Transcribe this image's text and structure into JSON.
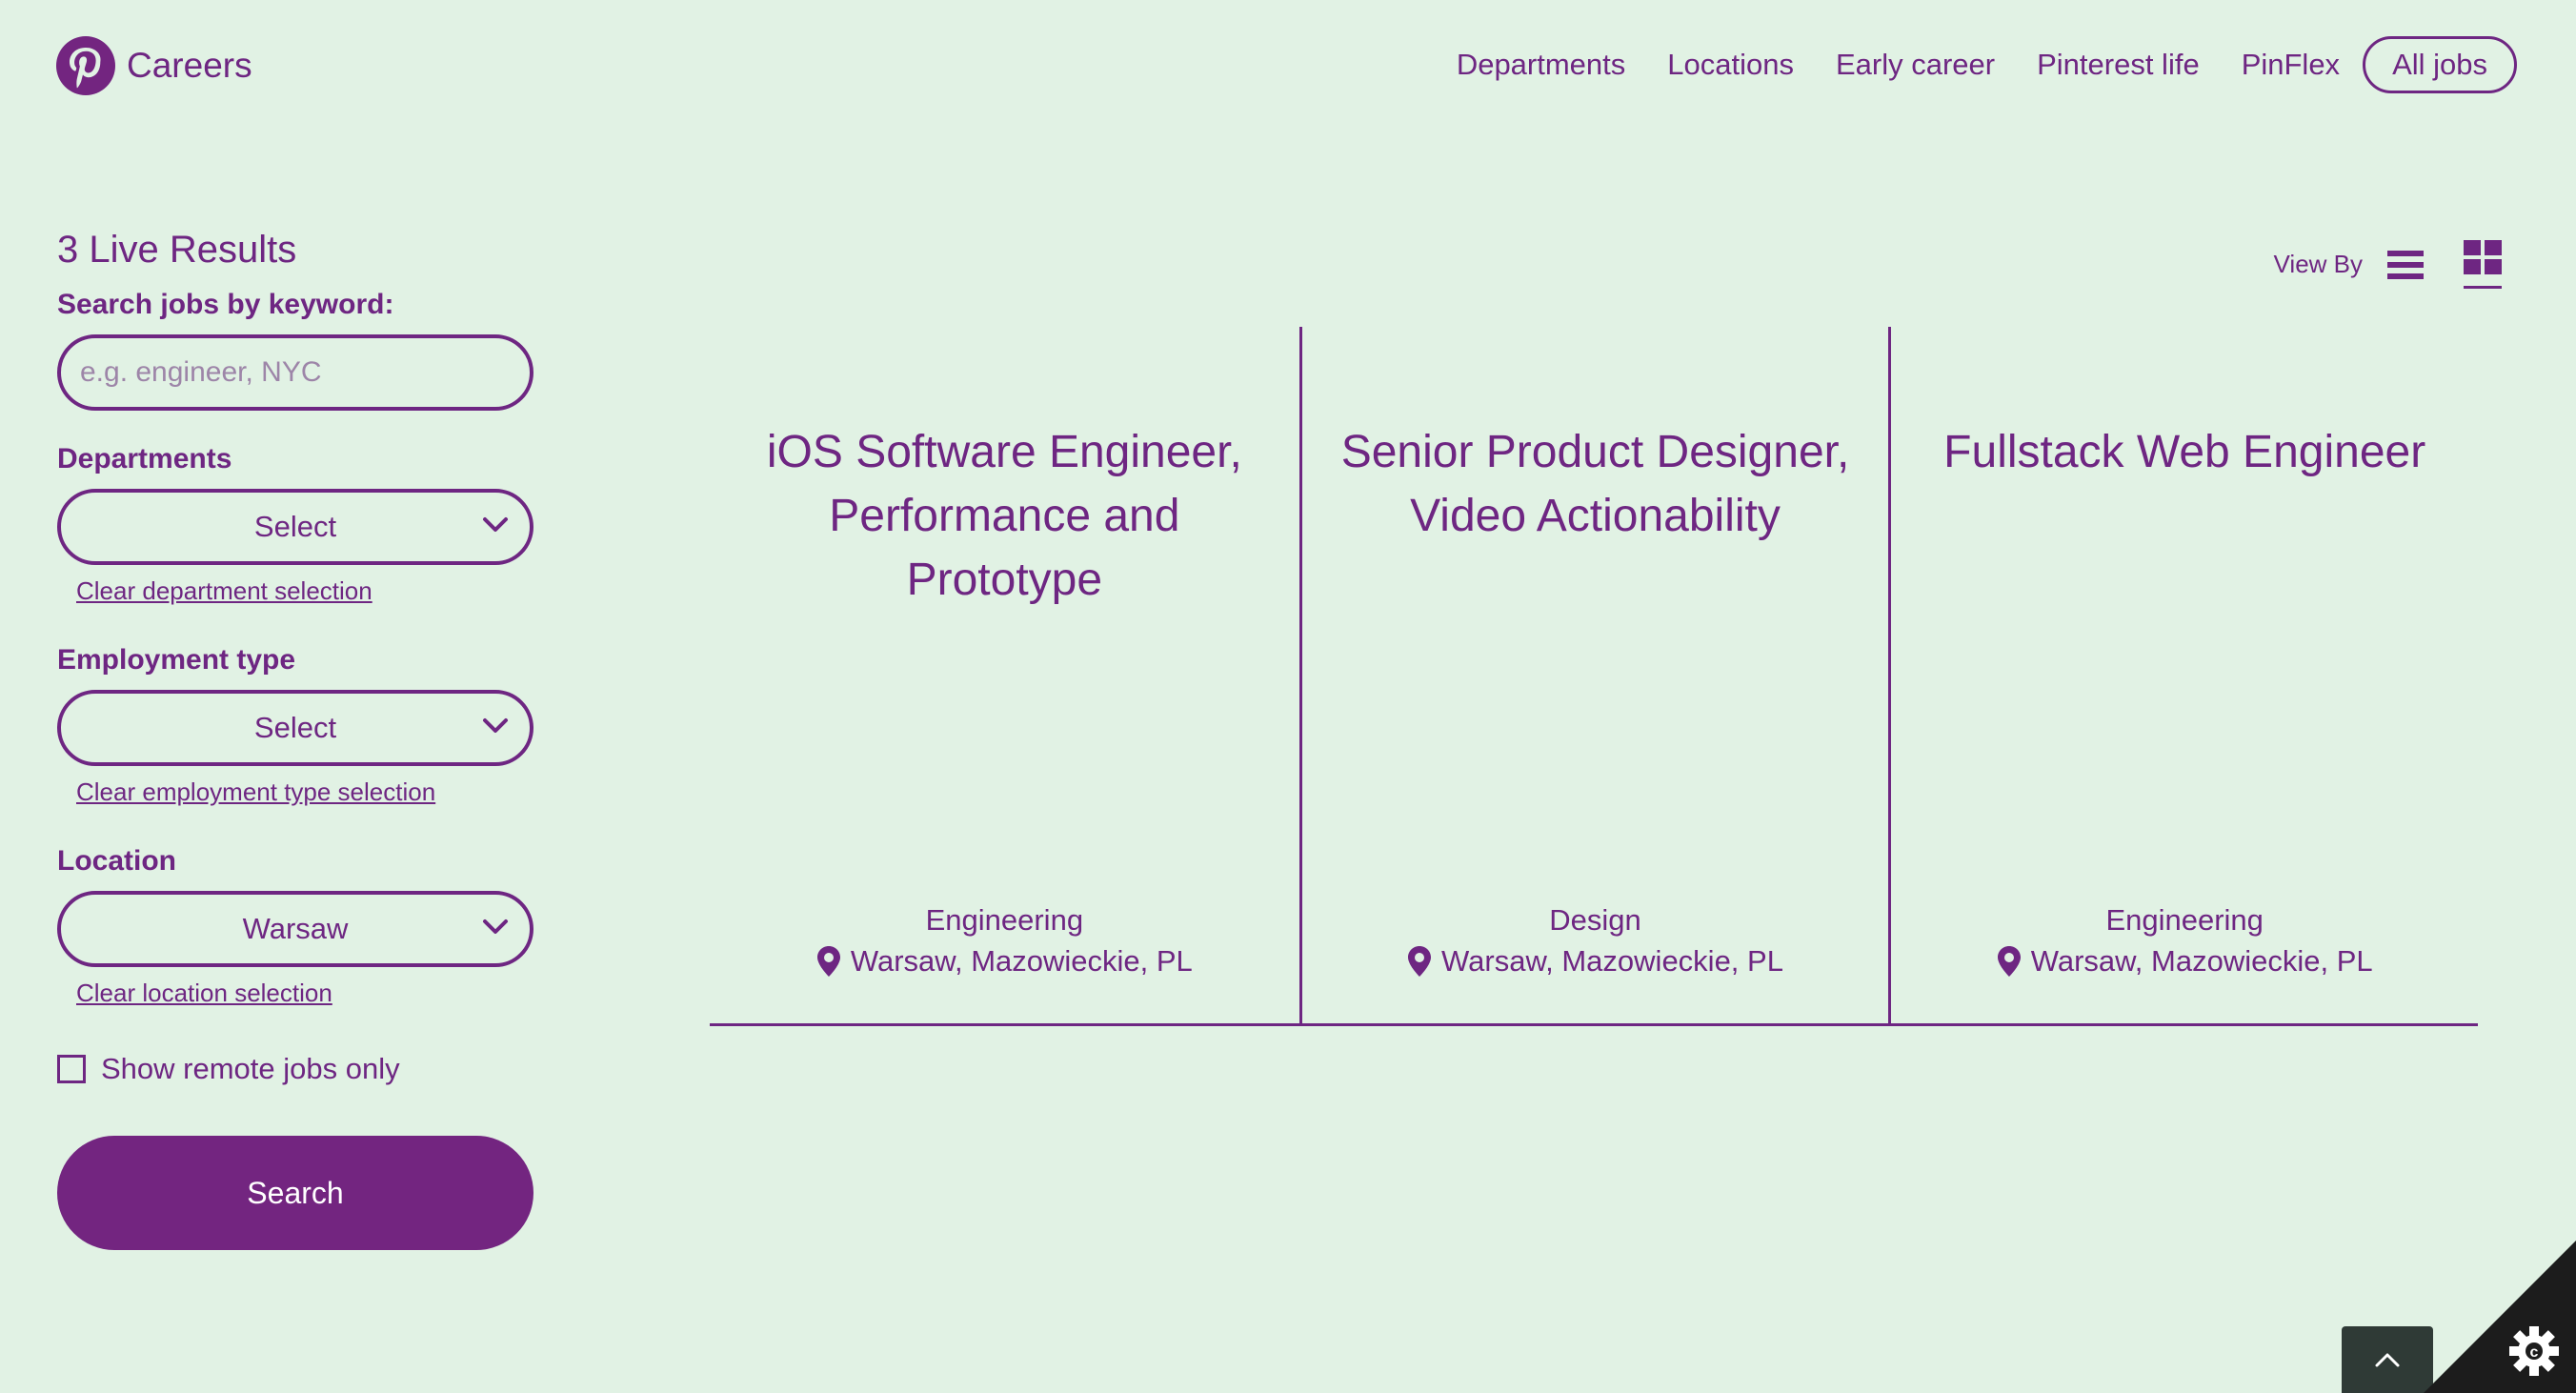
{
  "header": {
    "brand": "Careers",
    "nav": [
      {
        "label": "Departments"
      },
      {
        "label": "Locations"
      },
      {
        "label": "Early career"
      },
      {
        "label": "Pinterest life"
      },
      {
        "label": "PinFlex"
      }
    ],
    "all_jobs_label": "All jobs"
  },
  "sidebar": {
    "results_title": "3 Live Results",
    "keyword_label": "Search jobs by keyword:",
    "keyword_placeholder": "e.g. engineer, NYC",
    "keyword_value": "",
    "departments": {
      "label": "Departments",
      "value": "Select",
      "clear": "Clear department selection"
    },
    "employment": {
      "label": "Employment type",
      "value": "Select",
      "clear": "Clear employment type selection"
    },
    "location": {
      "label": "Location",
      "value": "Warsaw",
      "clear": "Clear location selection"
    },
    "remote_label": "Show remote jobs only",
    "remote_checked": false,
    "search_label": "Search"
  },
  "viewby": {
    "label": "View By",
    "active": "grid"
  },
  "jobs": [
    {
      "title": "iOS Software Engineer, Performance and Prototype",
      "department": "Engineering",
      "location": "Warsaw, Mazowieckie, PL"
    },
    {
      "title": "Senior Product Designer, Video Actionability",
      "department": "Design",
      "location": "Warsaw, Mazowieckie, PL"
    },
    {
      "title": "Fullstack Web Engineer",
      "department": "Engineering",
      "location": "Warsaw, Mazowieckie, PL"
    }
  ],
  "colors": {
    "accent": "#6e2682",
    "background": "#e1f2e4",
    "button": "#732580"
  }
}
